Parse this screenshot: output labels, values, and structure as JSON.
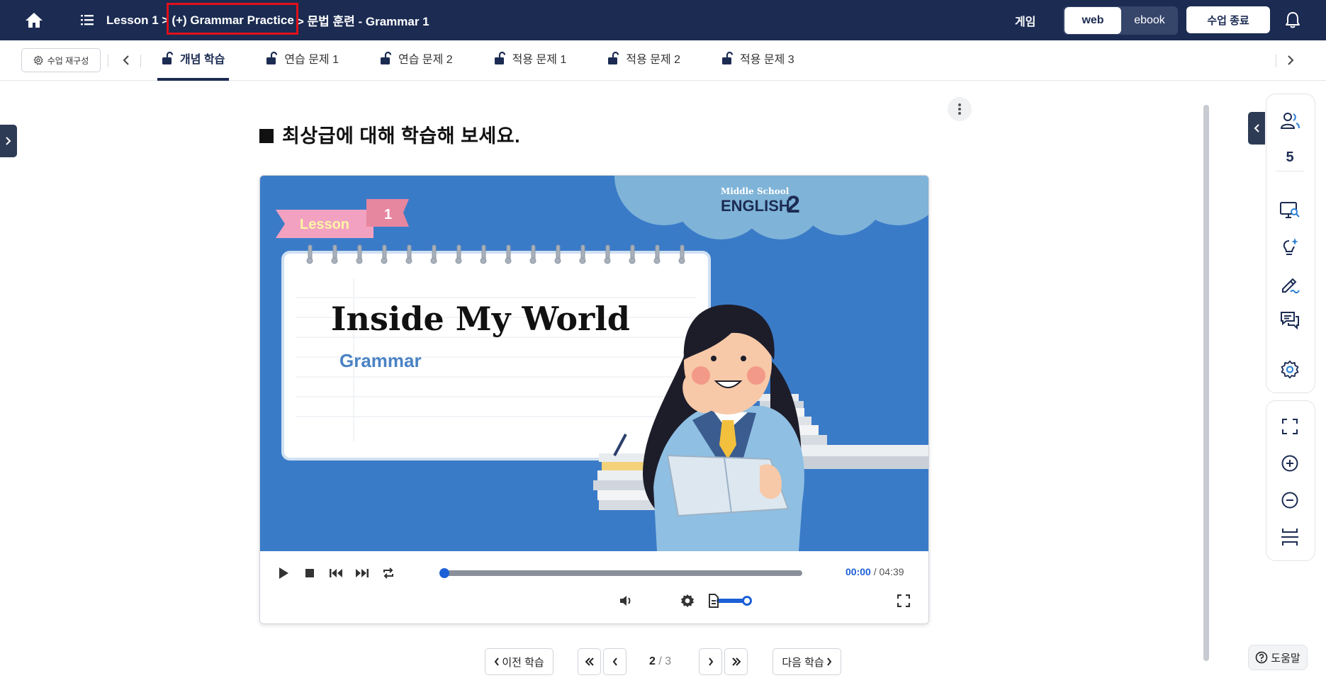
{
  "header": {
    "breadcrumb": [
      "Lesson 1 >",
      "(+) Grammar Practice",
      "> 문법 훈련 - Grammar 1"
    ],
    "game_label": "게임",
    "view_web": "web",
    "view_ebook": "ebook",
    "end_class_label": "수업 종료",
    "icons": [
      "home-icon",
      "list-menu-icon",
      "bell-icon"
    ]
  },
  "tabbar": {
    "reconfigure_label": "수업 재구성",
    "tabs": [
      {
        "label": "개념 학습",
        "active": true
      },
      {
        "label": "연습 문제 1",
        "active": false
      },
      {
        "label": "연습 문제 2",
        "active": false
      },
      {
        "label": "적용 문제 1",
        "active": false
      },
      {
        "label": "적용 문제 2",
        "active": false
      },
      {
        "label": "적용 문제 3",
        "active": false
      }
    ]
  },
  "content": {
    "instruction": "최상급에 대해 학습해 보세요."
  },
  "video": {
    "lesson_ribbon": "Lesson",
    "lesson_number": "1",
    "brand_small": "Middle School",
    "brand_big": "ENGLISH",
    "brand_grade": "2",
    "title": "Inside My World",
    "subtitle": "Grammar",
    "current_time": "00:00",
    "separator": "/",
    "total_time": "04:39",
    "progress": 0,
    "volume": 0.85,
    "colors": {
      "background": "#3a7bc8",
      "cloud": "#7fb3d8",
      "ribbon": "#f2a2c0",
      "accent": "#1c5fd6"
    }
  },
  "pagination": {
    "prev_label": "이전 학습",
    "next_label": "다음 학습",
    "current": "2",
    "total": "/ 3"
  },
  "sidebar": {
    "participant_count": "5",
    "icons": [
      "participants-icon",
      "screen-monitor-icon",
      "ai-lightbulb-icon",
      "pen-icon",
      "chat-icon",
      "settings-icon",
      "fullscreen-icon",
      "zoom-in-icon",
      "zoom-out-icon",
      "fit-height-icon"
    ]
  },
  "help_label": "도움말"
}
